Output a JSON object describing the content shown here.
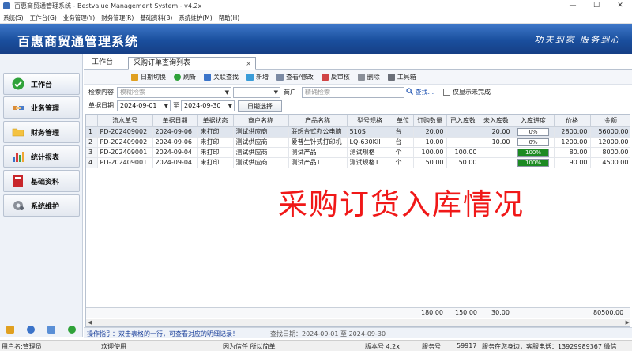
{
  "window": {
    "title": "百惠商贸通管理系统 - Bestvalue Management System - v4.2x"
  },
  "menu": [
    "系统(S)",
    "工作台(G)",
    "业务管理(Y)",
    "财务管理(R)",
    "基础资料(B)",
    "系统维护(M)",
    "帮助(H)"
  ],
  "banner": {
    "title": "百惠商贸通管理系统",
    "slogan": "功夫到家 服务到心"
  },
  "sidebar": [
    {
      "label": "工作台",
      "icon": "check-icon"
    },
    {
      "label": "业务管理",
      "icon": "handshake-icon"
    },
    {
      "label": "财务管理",
      "icon": "folder-icon"
    },
    {
      "label": "统计报表",
      "icon": "bar-chart-icon"
    },
    {
      "label": "基础资料",
      "icon": "book-icon"
    },
    {
      "label": "系统维护",
      "icon": "gear-icon"
    }
  ],
  "tabs": {
    "home": "工作台",
    "active": "采购订单查询列表",
    "close": "×"
  },
  "toolbar": [
    "日期切换",
    "刷新",
    "关联查找",
    "新增",
    "查看/修改",
    "反审核",
    "删除",
    "工具箱"
  ],
  "filter": {
    "search_label": "检索内容",
    "search_placeholder": "模糊检索",
    "vendor_label": "商户",
    "vendor_placeholder": "精确检索",
    "find_link": "查找...",
    "only_unfinished": "仅显示未完成",
    "date_label": "单据日期",
    "date_from": "2024-09-01",
    "date_sep": "至",
    "date_to": "2024-09-30",
    "date_btn": "日期选择"
  },
  "table": {
    "columns": [
      "",
      "流水单号",
      "单据日期",
      "单据状态",
      "商户名称",
      "产品名称",
      "型号规格",
      "单位",
      "订购数量",
      "已入库数",
      "未入库数",
      "入库进度",
      "价格",
      "金额"
    ],
    "rows": [
      {
        "n": "1",
        "no": "PD-202409002",
        "date": "2024-09-06",
        "status": "未打印",
        "vendor": "测试供应商",
        "product": "联想台式办公电脑",
        "model": "510S",
        "unit": "台",
        "qty": "20.00",
        "in": "",
        "out": "20.00",
        "progress": 0,
        "progress_text": "0%",
        "price": "2800.00",
        "amount": "56000.00"
      },
      {
        "n": "2",
        "no": "PD-202409002",
        "date": "2024-09-06",
        "status": "未打印",
        "vendor": "测试供应商",
        "product": "爱普生针式打印机",
        "model": "LQ-630KII",
        "unit": "台",
        "qty": "10.00",
        "in": "",
        "out": "10.00",
        "progress": 0,
        "progress_text": "0%",
        "price": "1200.00",
        "amount": "12000.00"
      },
      {
        "n": "3",
        "no": "PD-202409001",
        "date": "2024-09-04",
        "status": "未打印",
        "vendor": "测试供应商",
        "product": "测试产品",
        "model": "测试规格",
        "unit": "个",
        "qty": "100.00",
        "in": "100.00",
        "out": "",
        "progress": 100,
        "progress_text": "100%",
        "price": "80.00",
        "amount": "8000.00"
      },
      {
        "n": "4",
        "no": "PD-202409001",
        "date": "2024-09-04",
        "status": "未打印",
        "vendor": "测试供应商",
        "product": "测试产品1",
        "model": "测试规格1",
        "unit": "个",
        "qty": "50.00",
        "in": "50.00",
        "out": "",
        "progress": 100,
        "progress_text": "100%",
        "price": "90.00",
        "amount": "4500.00"
      }
    ],
    "totals": {
      "qty": "180.00",
      "in": "150.00",
      "out": "30.00",
      "amount": "80500.00"
    }
  },
  "overlay": "采购订货入库情况",
  "hint": {
    "tip": "操作指引：双击表格的一行，可查看对应的明细记录！",
    "range": "查找日期：2024-09-01 至 2024-09-30"
  },
  "status": {
    "user": "用户名:管理员",
    "welcome": "欢迎使用",
    "motto": "因为信任 所以简单",
    "version": "版本号 4.2x",
    "service_label": "服务号",
    "service_no": "59917",
    "contact": "服务在您身边，客服电话：13929989367 微信"
  },
  "colors": {
    "banner": "#1a4f9e",
    "overlay": "#f01818",
    "progress": "#1c8a22"
  }
}
